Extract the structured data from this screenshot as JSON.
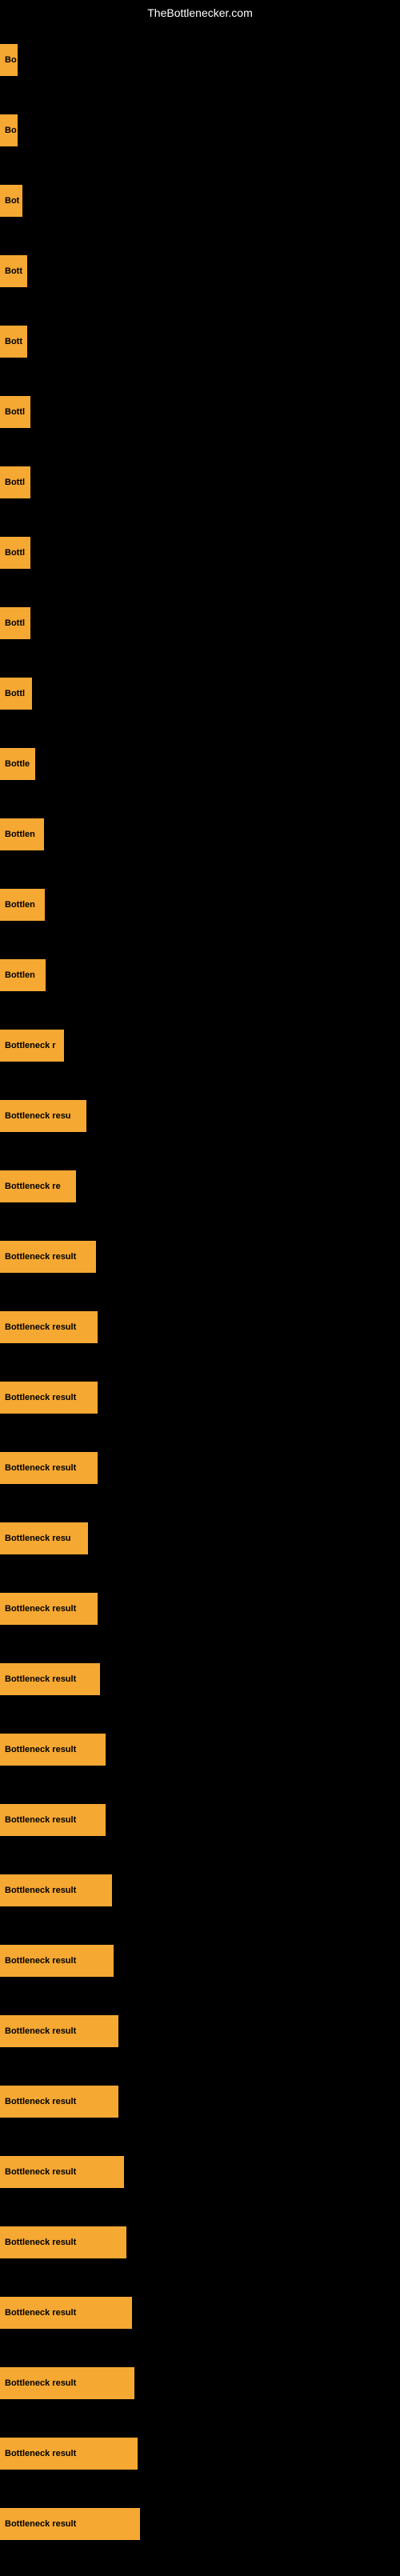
{
  "site": {
    "title": "TheBottlenecker.com"
  },
  "items": [
    {
      "label": "Bo",
      "width": 22
    },
    {
      "label": "Bo",
      "width": 22
    },
    {
      "label": "Bot",
      "width": 28
    },
    {
      "label": "Bott",
      "width": 34
    },
    {
      "label": "Bott",
      "width": 34
    },
    {
      "label": "Bottl",
      "width": 38
    },
    {
      "label": "Bottl",
      "width": 38
    },
    {
      "label": "Bottl",
      "width": 38
    },
    {
      "label": "Bottl",
      "width": 38
    },
    {
      "label": "Bottl",
      "width": 40
    },
    {
      "label": "Bottle",
      "width": 44
    },
    {
      "label": "Bottlen",
      "width": 55
    },
    {
      "label": "Bottlen",
      "width": 56
    },
    {
      "label": "Bottlen",
      "width": 57
    },
    {
      "label": "Bottleneck r",
      "width": 80
    },
    {
      "label": "Bottleneck resu",
      "width": 108
    },
    {
      "label": "Bottleneck re",
      "width": 95
    },
    {
      "label": "Bottleneck result",
      "width": 120
    },
    {
      "label": "Bottleneck result",
      "width": 122
    },
    {
      "label": "Bottleneck result",
      "width": 122
    },
    {
      "label": "Bottleneck result",
      "width": 122
    },
    {
      "label": "Bottleneck resu",
      "width": 110
    },
    {
      "label": "Bottleneck result",
      "width": 122
    },
    {
      "label": "Bottleneck result",
      "width": 125
    },
    {
      "label": "Bottleneck result",
      "width": 132
    },
    {
      "label": "Bottleneck result",
      "width": 132
    },
    {
      "label": "Bottleneck result",
      "width": 140
    },
    {
      "label": "Bottleneck result",
      "width": 142
    },
    {
      "label": "Bottleneck result",
      "width": 148
    },
    {
      "label": "Bottleneck result",
      "width": 148
    },
    {
      "label": "Bottleneck result",
      "width": 155
    },
    {
      "label": "Bottleneck result",
      "width": 158
    },
    {
      "label": "Bottleneck result",
      "width": 165
    },
    {
      "label": "Bottleneck result",
      "width": 168
    },
    {
      "label": "Bottleneck result",
      "width": 172
    },
    {
      "label": "Bottleneck result",
      "width": 175
    }
  ]
}
